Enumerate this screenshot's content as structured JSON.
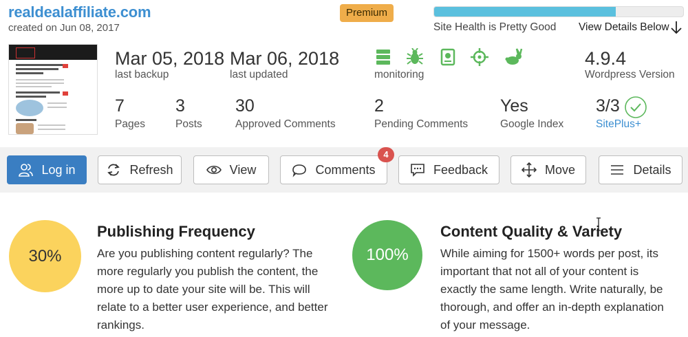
{
  "site": {
    "url": "realdealaffiliate.com",
    "created": "created on Jun 08, 2017",
    "plan_badge": "Premium"
  },
  "health": {
    "progress_percent": 73,
    "text": "Site Health is Pretty Good",
    "details_link": "View Details Below"
  },
  "dates": {
    "backup": {
      "value": "Mar 05, 2018",
      "label": "last backup"
    },
    "updated": {
      "value": "Mar 06, 2018",
      "label": "last updated"
    }
  },
  "monitoring": {
    "label": "monitoring",
    "icons": [
      "server-icon",
      "bug-icon",
      "drive-icon",
      "target-icon",
      "rabbit-icon"
    ],
    "color": "#5cb85c"
  },
  "wordpress": {
    "version": "4.9.4",
    "label": "Wordpress Version"
  },
  "stats": [
    {
      "value": "7",
      "label": "Pages"
    },
    {
      "value": "3",
      "label": "Posts"
    },
    {
      "value": "30",
      "label": "Approved Comments"
    },
    {
      "value": "2",
      "label": "Pending Comments"
    },
    {
      "value": "Yes",
      "label": "Google Index"
    }
  ],
  "siteplus": {
    "value": "3/3",
    "label": "SitePlus+"
  },
  "toolbar": {
    "login": "Log in",
    "refresh": "Refresh",
    "view": "View",
    "comments": "Comments",
    "comments_count": "4",
    "feedback": "Feedback",
    "move": "Move",
    "details": "Details"
  },
  "sections": [
    {
      "percent": "30%",
      "title": "Publishing Frequency",
      "lines": [
        "Are you publishing content regularly? The",
        "more regularly you publish the content, the",
        "more up to date your site will be. This will",
        "relate to a better user experience, and better",
        "rankings."
      ],
      "color": "#fbd35d"
    },
    {
      "percent": "100%",
      "title": "Content Quality & Variety",
      "lines": [
        "While aiming for 1500+ words per post, its",
        "important that not all of your content is",
        "exactly the same length. Write naturally, be",
        "thorough, and offer an in-depth explanation",
        "of your message."
      ],
      "color": "#5cb85c"
    }
  ],
  "colors": {
    "accent": "#3d8fd1",
    "primary_button": "#3a7ec2",
    "badge": "#efad4a",
    "health_fill": "#5bc0de",
    "notify": "#d9534f"
  }
}
